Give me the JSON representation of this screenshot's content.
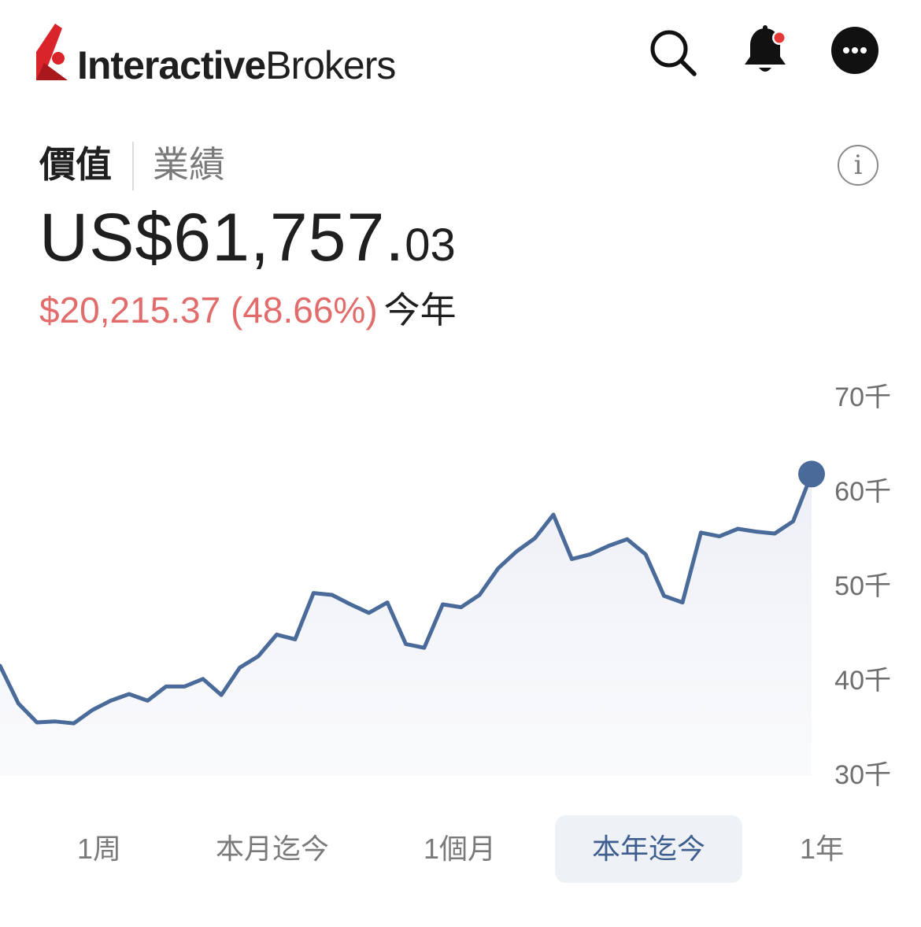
{
  "header": {
    "logo_bold": "Interactive",
    "logo_regular": "Brokers",
    "brand_red": "#d9252a",
    "icons": [
      "search-icon",
      "bell-icon",
      "more-icon"
    ],
    "notification_dot_color": "#e53935"
  },
  "tabs": {
    "value_label": "價值",
    "performance_label": "業績",
    "active": "價值",
    "info_label": "i"
  },
  "portfolio": {
    "value_main": "US$61,757.",
    "value_cents": "03",
    "change_text": "$20,215.37 (48.66%)",
    "change_period": "今年",
    "change_color": "#e26b6b"
  },
  "chart_data": {
    "type": "area",
    "title": "",
    "xlabel": "",
    "ylabel": "",
    "ylim": [
      30,
      70
    ],
    "yticks": [
      "70千",
      "60千",
      "50千",
      "40千",
      "30千"
    ],
    "ytick_values": [
      70,
      60,
      50,
      40,
      30
    ],
    "grid": false,
    "line_color": "#4a6a9a",
    "fill_color": "#f1f3f8",
    "series": [
      {
        "values": [
          41.5,
          37.5,
          35.5,
          35.6,
          35.4,
          36.8,
          37.8,
          38.5,
          37.8,
          39.3,
          39.3,
          40.1,
          38.4,
          41.3,
          42.5,
          44.8,
          44.3,
          49.2,
          49.0,
          48.0,
          47.1,
          48.2,
          43.8,
          43.4,
          48.0,
          47.7,
          49.0,
          51.8,
          53.6,
          55.0,
          57.5,
          52.8,
          53.3,
          54.2,
          54.9,
          53.3,
          48.9,
          48.2,
          55.6,
          55.2,
          56.0,
          55.7,
          55.5,
          56.8,
          61.8
        ]
      }
    ],
    "last_value_marker": true
  },
  "range_selector": {
    "options": [
      "1周",
      "本月迄今",
      "1個月",
      "本年迄今",
      "1年"
    ],
    "active": "本年迄今"
  }
}
